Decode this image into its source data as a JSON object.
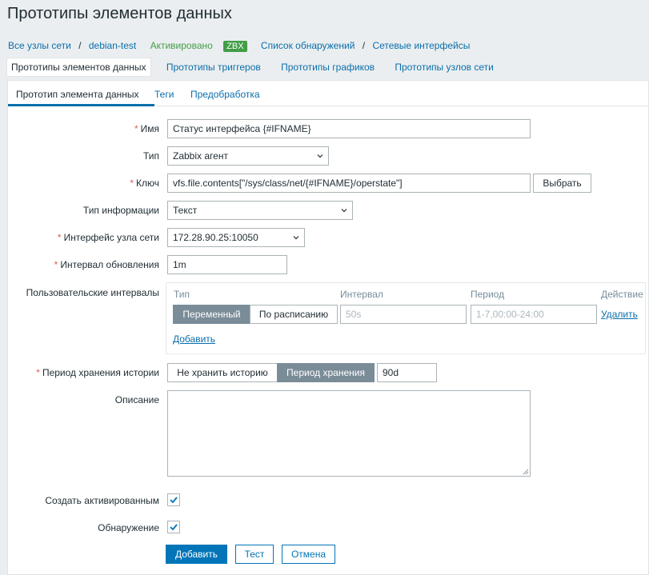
{
  "page": {
    "title": "Прототипы элементов данных"
  },
  "breadcrumb": {
    "all_hosts": "Все узлы сети",
    "separator": "/",
    "host": "debian-test",
    "status": "Активировано",
    "zbx_badge": "ZBX",
    "discovery_list": "Список обнаружений",
    "discovery_rule": "Сетевые интерфейсы"
  },
  "subnav": {
    "items": [
      {
        "label": "Прототипы элементов данных"
      },
      {
        "label": "Прототипы триггеров"
      },
      {
        "label": "Прототипы графиков"
      },
      {
        "label": "Прототипы узлов сети"
      }
    ]
  },
  "tabs": [
    {
      "label": "Прототип элемента данных"
    },
    {
      "label": "Теги"
    },
    {
      "label": "Предобработка"
    }
  ],
  "form": {
    "required_mark": "*",
    "name": {
      "label": "Имя",
      "value": "Статус интерфейса {#IFNAME}"
    },
    "type": {
      "label": "Тип",
      "value": "Zabbix агент"
    },
    "key": {
      "label": "Ключ",
      "value": "vfs.file.contents[\"/sys/class/net/{#IFNAME}/operstate\"]",
      "select_label": "Выбрать"
    },
    "info_type": {
      "label": "Тип информации",
      "value": "Текст"
    },
    "interface": {
      "label": "Интерфейс узла сети",
      "value": "172.28.90.25:10050"
    },
    "update_interval": {
      "label": "Интервал обновления",
      "value": "1m"
    },
    "custom_intervals": {
      "label": "Пользовательские интервалы",
      "col_type": "Тип",
      "col_interval": "Интервал",
      "col_period": "Период",
      "col_action": "Действие",
      "flexible": "Переменный",
      "scheduling": "По расписанию",
      "interval_placeholder": "50s",
      "period_placeholder": "1-7,00:00-24:00",
      "remove": "Удалить",
      "add": "Добавить"
    },
    "history": {
      "label": "Период хранения истории",
      "do_not_keep": "Не хранить историю",
      "storage_period": "Период хранения",
      "value": "90d"
    },
    "description": {
      "label": "Описание",
      "value": ""
    },
    "create_enabled": {
      "label": "Создать активированным",
      "checked": true
    },
    "discover": {
      "label": "Обнаружение",
      "checked": true
    }
  },
  "actions": {
    "add": "Добавить",
    "test": "Тест",
    "cancel": "Отмена"
  },
  "colors": {
    "link": "#0a6fab",
    "enabled": "#429e47",
    "required": "#e45959",
    "primary": "#0275b8",
    "segment_active": "#7a8c98"
  }
}
